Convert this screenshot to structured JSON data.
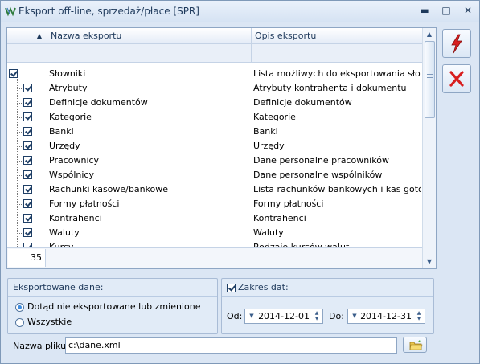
{
  "window": {
    "title": "Eksport off-line, sprzedaż/płace [SPR]",
    "minimize_glyph": "▬",
    "maximize_glyph": "□",
    "close_glyph": "✕"
  },
  "grid": {
    "sort_glyph": "▲",
    "columns": [
      "Nazwa eksportu",
      "Opis eksportu"
    ],
    "rows": [
      {
        "name": "Słowniki",
        "desc": "Lista możliwych do eksportowania słowni…",
        "checked": true
      },
      {
        "name": "Atrybuty",
        "desc": "Atrybuty kontrahenta i dokumentu",
        "checked": true
      },
      {
        "name": "Definicje dokumentów",
        "desc": "Definicje dokumentów",
        "checked": true
      },
      {
        "name": "Kategorie",
        "desc": "Kategorie",
        "checked": true
      },
      {
        "name": "Banki",
        "desc": "Banki",
        "checked": true
      },
      {
        "name": "Urzędy",
        "desc": "Urzędy",
        "checked": true
      },
      {
        "name": "Pracownicy",
        "desc": "Dane personalne pracowników",
        "checked": true
      },
      {
        "name": "Wspólnicy",
        "desc": "Dane personalne wspólników",
        "checked": true
      },
      {
        "name": "Rachunki kasowe/bankowe",
        "desc": "Lista rachunków bankowych i kas gotówk…",
        "checked": true
      },
      {
        "name": "Formy płatności",
        "desc": "Formy płatności",
        "checked": true
      },
      {
        "name": "Kontrahenci",
        "desc": "Kontrahenci",
        "checked": true
      },
      {
        "name": "Waluty",
        "desc": "Waluty",
        "checked": true
      },
      {
        "name": "Kursy",
        "desc": "Rodzaje kursów walut",
        "checked": true
      }
    ],
    "count": "35",
    "scroll_up_glyph": "▲",
    "scroll_down_glyph": "▼"
  },
  "side_buttons": {
    "run_icon": "lightning-icon",
    "cancel_icon": "x-icon"
  },
  "exported": {
    "title": "Eksportowane dane:",
    "options": [
      "Dotąd nie eksportowane lub zmienione",
      "Wszystkie"
    ],
    "selected_index": 0
  },
  "date_range": {
    "label": "Zakres dat:",
    "checked": true,
    "from_label": "Od:",
    "from_value": "2014-12-01",
    "to_label": "Do:",
    "to_value": "2014-12-31"
  },
  "file": {
    "label": "Nazwa pliku:",
    "value": "c:\\dane.xml"
  },
  "colors": {
    "accent": "#3f8de0",
    "run_red": "#d81f1f",
    "frame": "#8ea6c4"
  }
}
